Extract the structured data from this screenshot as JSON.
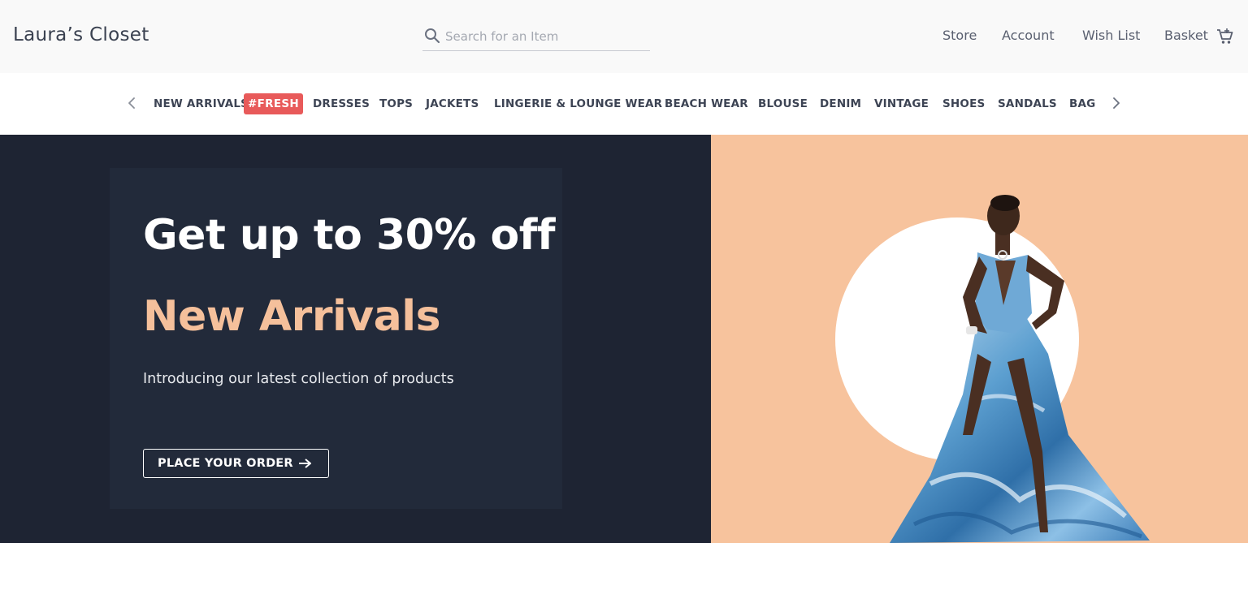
{
  "header": {
    "logo": "Laura’s Closet",
    "search": {
      "placeholder": "Search for an Item",
      "value": "",
      "icon": "search-icon"
    },
    "nav": [
      {
        "label": "Store"
      },
      {
        "label": "Account"
      },
      {
        "label": "Wish List"
      },
      {
        "label": "Basket",
        "icon": "shopping-cart-icon"
      }
    ]
  },
  "categories": {
    "prev_icon": "chevron-left-icon",
    "next_icon": "chevron-right-icon",
    "badge": "#FRESH",
    "items": [
      "NEW ARRIVALS",
      "DRESSES",
      "TOPS",
      "JACKETS",
      "LINGERIE & LOUNGE WEAR",
      "BEACH WEAR",
      "BLOUSE",
      "DENIM",
      "VINTAGE",
      "SHOES",
      "SANDALS",
      "BAGS"
    ]
  },
  "hero": {
    "title": "Get up to 30% off",
    "subtitle": "New Arrivals",
    "description": "Introducing our latest collection of products",
    "cta_label": "PLACE YOUR ORDER",
    "cta_icon": "arrow-right-icon",
    "image": "model-in-blue-dress"
  },
  "colors": {
    "hero_dark": "#1e2433",
    "hero_card": "#222a3a",
    "accent_peach": "#f5c09b",
    "hero_right_bg": "#f7c39d",
    "badge_red": "#e85a5a"
  }
}
